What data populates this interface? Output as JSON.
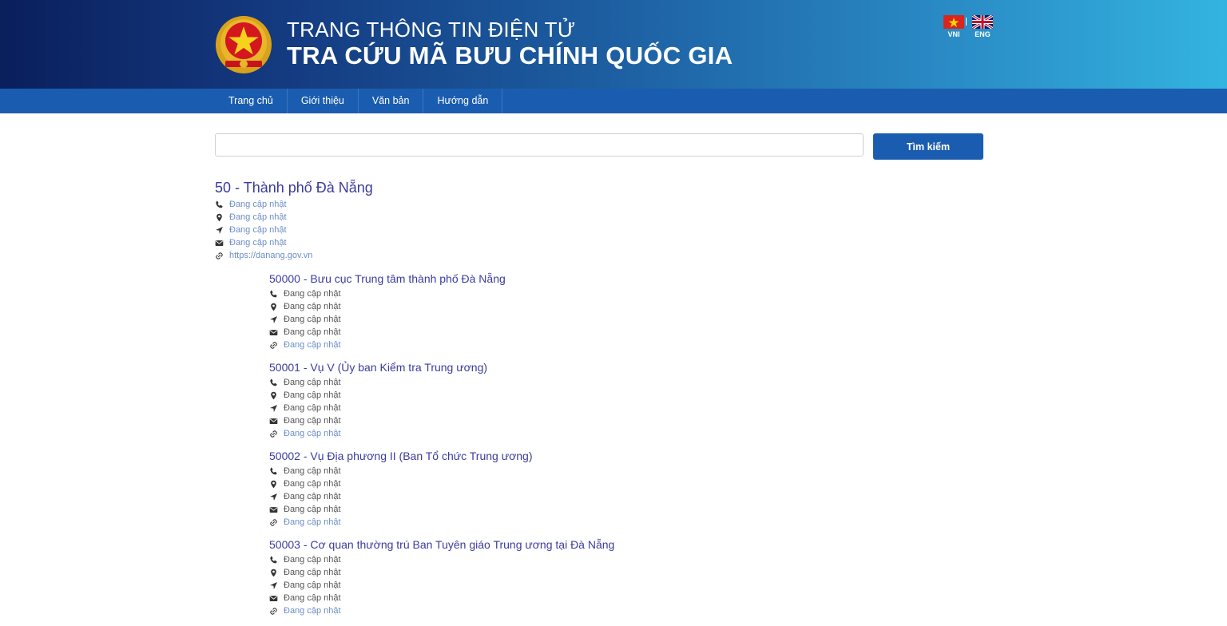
{
  "header": {
    "line1": "TRANG THÔNG TIN ĐIỆN TỬ",
    "line2": "TRA CỨU MÃ BƯU CHÍNH QUỐC GIA",
    "languages": [
      {
        "code": "VNI",
        "icon": "vietnam-flag-icon"
      },
      {
        "code": "ENG",
        "icon": "uk-flag-icon"
      }
    ],
    "emblem": "national-emblem-logo"
  },
  "nav": {
    "items": [
      "Trang chủ",
      "Giới thiệu",
      "Văn bản",
      "Hướng dẫn"
    ]
  },
  "search": {
    "value": "",
    "placeholder": "",
    "button_label": "Tìm kiếm"
  },
  "main_entry": {
    "title": "50 - Thành phố Đà Nẵng",
    "phone": "Đang cập nhật",
    "address": "Đang cập nhật",
    "location": "Đang cập nhật",
    "email": "Đang cập nhật",
    "website": "https://danang.gov.vn"
  },
  "sub_entries": [
    {
      "title": "50000 - Bưu cục Trung tâm thành phố Đà Nẵng",
      "phone": "Đang cập nhật",
      "address": "Đang cập nhật",
      "location": "Đang cập nhật",
      "email": "Đang cập nhật",
      "website": "Đang cập nhật"
    },
    {
      "title": "50001 - Vụ V (Ủy ban Kiểm tra Trung ương)",
      "phone": "Đang cập nhật",
      "address": "Đang cập nhật",
      "location": "Đang cập nhật",
      "email": "Đang cập nhật",
      "website": "Đang cập nhật"
    },
    {
      "title": "50002 - Vụ Địa phương II (Ban Tổ chức Trung ương)",
      "phone": "Đang cập nhật",
      "address": "Đang cập nhật",
      "location": "Đang cập nhật",
      "email": "Đang cập nhật",
      "website": "Đang cập nhật"
    },
    {
      "title": "50003 - Cơ quan thường trú Ban Tuyên giáo Trung ương tại Đà Nẵng",
      "phone": "Đang cập nhật",
      "address": "Đang cập nhật",
      "location": "Đang cập nhật",
      "email": "Đang cập nhật",
      "website": "Đang cập nhật"
    }
  ],
  "icons": [
    "phone-icon",
    "map-marker-icon",
    "location-arrow-icon",
    "envelope-icon",
    "link-icon"
  ],
  "colors": {
    "header_start": "#0a1f5c",
    "header_end": "#33b4e0",
    "nav_bg": "#1a5db0",
    "button_bg": "#1a5db0",
    "title_color": "#3b3b9f",
    "link_color": "#6c8ec6"
  }
}
